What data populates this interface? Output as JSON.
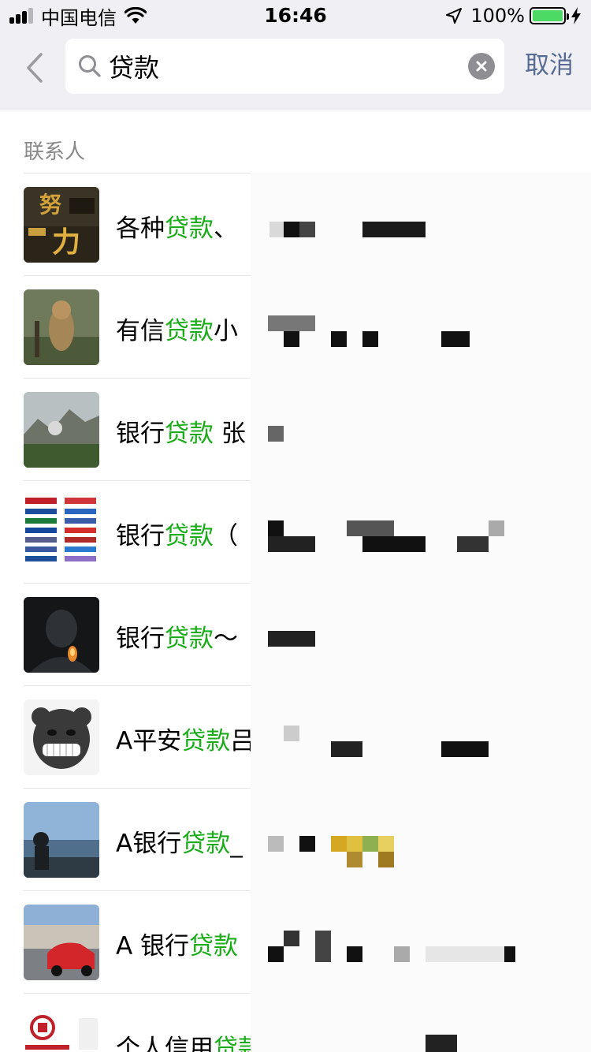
{
  "status_bar": {
    "carrier": "中国电信",
    "time": "16:46",
    "battery_percent": "100%",
    "battery_level": 1.0,
    "signal_bars_active": 3,
    "icons": [
      "signal-icon",
      "wifi-icon",
      "location-arrow-icon",
      "battery-icon",
      "charging-bolt-icon"
    ]
  },
  "search": {
    "query": "贷款",
    "cancel_label": "取消",
    "icons": [
      "back-chevron-icon",
      "search-icon",
      "clear-icon"
    ]
  },
  "section": {
    "title": "联系人"
  },
  "contacts": [
    {
      "prefix": "各种",
      "highlight": "贷款",
      "suffix": "、"
    },
    {
      "prefix": "有信",
      "highlight": "贷款",
      "suffix": "小"
    },
    {
      "prefix": "银行",
      "highlight": "贷款",
      "suffix": " 张"
    },
    {
      "prefix": "银行",
      "highlight": "贷款",
      "suffix": "（"
    },
    {
      "prefix": "银行",
      "highlight": "贷款",
      "suffix": "～"
    },
    {
      "prefix": "A平安",
      "highlight": "贷款",
      "suffix": "吕"
    },
    {
      "prefix": "A银行",
      "highlight": "贷款",
      "suffix": "_"
    },
    {
      "prefix": "A 银行",
      "highlight": "贷款",
      "suffix": ""
    },
    {
      "prefix": "个人信用",
      "highlight": "贷款",
      "suffix": ""
    }
  ],
  "colors": {
    "highlight": "#1aad19",
    "link": "#576b95",
    "header_bg": "#efeff4",
    "battery": "#4cd964"
  }
}
